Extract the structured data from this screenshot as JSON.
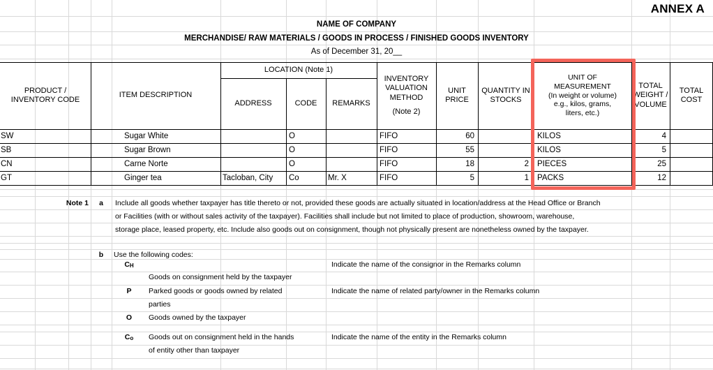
{
  "annex": "ANNEX A",
  "titles": {
    "company": "NAME OF COMPANY",
    "form": "MERCHANDISE/ RAW MATERIALS / GOODS IN PROCESS / FINISHED GOODS INVENTORY",
    "asof": "As of December 31, 20__"
  },
  "table": {
    "headers": {
      "product_code": "PRODUCT /\nINVENTORY CODE",
      "product_code_l1": "PRODUCT /",
      "product_code_l2": "INVENTORY CODE",
      "item_description": "ITEM DESCRIPTION",
      "location_group": "LOCATION (Note 1)",
      "address": "ADDRESS",
      "code": "CODE",
      "remarks": "REMARKS",
      "valuation_l1": "INVENTORY",
      "valuation_l2": "VALUATION",
      "valuation_l3": "METHOD",
      "valuation_l4": "(Note 2)",
      "unit_price_l1": "UNIT",
      "unit_price_l2": "PRICE",
      "quantity_l1": "QUANTITY IN",
      "quantity_l2": "STOCKS",
      "uom_l1": "UNIT OF",
      "uom_l2": "MEASUREMENT",
      "uom_l3": "(In weight or volume)",
      "uom_l4": "e.g., kilos, grams,",
      "uom_l5": "liters, etc.)",
      "total_weight_l1": "TOTAL",
      "total_weight_l2": "WEIGHT /",
      "total_weight_l3": "VOLUME",
      "total_cost_l1": "TOTAL",
      "total_cost_l2": "COST"
    },
    "rows": [
      {
        "product_code": "SW",
        "item_description": "Sugar White",
        "address": "",
        "code": "O",
        "remarks": "",
        "valuation_method": "FIFO",
        "unit_price": "60",
        "quantity": "",
        "uom": "KILOS",
        "total_weight": "4",
        "total_cost": ""
      },
      {
        "product_code": "SB",
        "item_description": "Sugar Brown",
        "address": "",
        "code": "O",
        "remarks": "",
        "valuation_method": "FIFO",
        "unit_price": "55",
        "quantity": "",
        "uom": "KILOS",
        "total_weight": "5",
        "total_cost": ""
      },
      {
        "product_code": "CN",
        "item_description": "Carne Norte",
        "address": "",
        "code": "O",
        "remarks": "",
        "valuation_method": "FIFO",
        "unit_price": "18",
        "quantity": "2",
        "uom": "PIECES",
        "total_weight": "25",
        "total_cost": ""
      },
      {
        "product_code": "GT",
        "item_description": "Ginger tea",
        "address": "Tacloban, City",
        "code": "Co",
        "remarks": "Mr. X",
        "valuation_method": "FIFO",
        "unit_price": "5",
        "quantity": "1",
        "uom": "PACKS",
        "total_weight": "12",
        "total_cost": ""
      }
    ]
  },
  "notes": {
    "note1_label": "Note 1",
    "item_a_marker": "a",
    "item_a_line1": "Include all goods whether taxpayer has title thereto or not, provided these goods are actually situated in location/address at the Head Office or Branch",
    "item_a_line2": "or Facilities (with or without sales activity of the taxpayer).  Facilities shall include but not limited to place of production, showroom, warehouse,",
    "item_a_line3": "storage place, leased property, etc.  Include also goods out on consignment, though not physically present are nonetheless owned by the taxpayer.",
    "item_b_marker": "b",
    "item_b_title": "Use the following codes:",
    "codes": [
      {
        "code_main": "C",
        "code_sub": "H",
        "description": "Goods on consignment held by the taxpayer",
        "remark": "Indicate the name of the consignor in the Remarks column"
      },
      {
        "code_main": "P",
        "code_sub": "",
        "description_l1": "Parked goods or goods owned by related",
        "description_l2": "parties",
        "remark": "Indicate the name of related party/owner in the Remarks column"
      },
      {
        "code_main": "O",
        "code_sub": "",
        "description": "Goods owned by the taxpayer",
        "remark": ""
      },
      {
        "code_main": "C",
        "code_sub": "o",
        "description_l1": "Goods out on consignment held in the hands",
        "description_l2": "of entity other than taxpayer",
        "remark": "Indicate the name of the entity in the Remarks column"
      }
    ]
  },
  "highlight": {
    "color": "#f4645a",
    "target_column": "UNIT OF MEASUREMENT"
  }
}
